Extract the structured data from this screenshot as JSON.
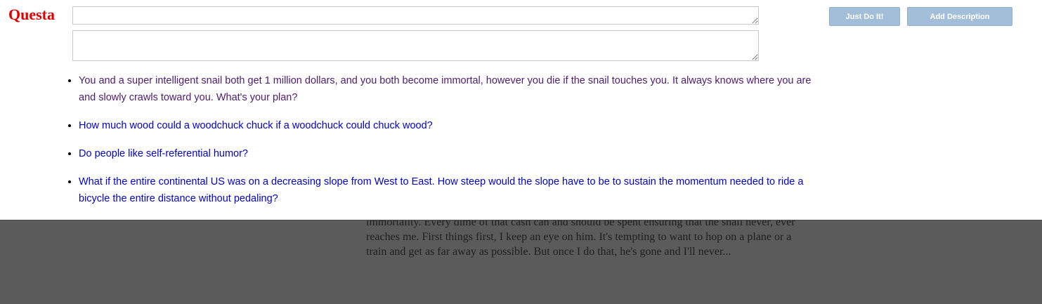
{
  "app": {
    "logo_text": "Questa"
  },
  "form": {
    "title_value": "",
    "description_value": "",
    "just_do_it_label": "Just Do It!",
    "add_description_label": "Add Description"
  },
  "suggestions": [
    {
      "text": "You and a super intelligent snail both get 1 million dollars, and you both become immortal, however you die if the snail touches you. It always knows where you are and slowly crawls toward you. What's your plan?",
      "visited": true
    },
    {
      "text": "How much wood could a woodchuck chuck if a woodchuck could chuck wood?",
      "visited": false
    },
    {
      "text": "Do people like self-referential humor?",
      "visited": false
    },
    {
      "text": "What if the entire continental US was on a decreasing slope from West to East. How steep would the slope have to be to sustain the momentum needed to ride a bicycle the entire distance without pedaling?",
      "visited": false
    }
  ],
  "background": {
    "answer_excerpt": "immortality. Every dime of that cash can and should be spent ensuring that the snail never, ever reaches me. First things first, I keep an eye on him. It's tempting to want to hop on a plane or a train and get as far away as possible. But once I do that, he's gone and I'll never..."
  },
  "colors": {
    "logo": "#e00000",
    "button_bg": "#a3bed8",
    "link": "#0000d8",
    "visited_link": "#4e1a72",
    "overlay": "#5b5b5b"
  }
}
